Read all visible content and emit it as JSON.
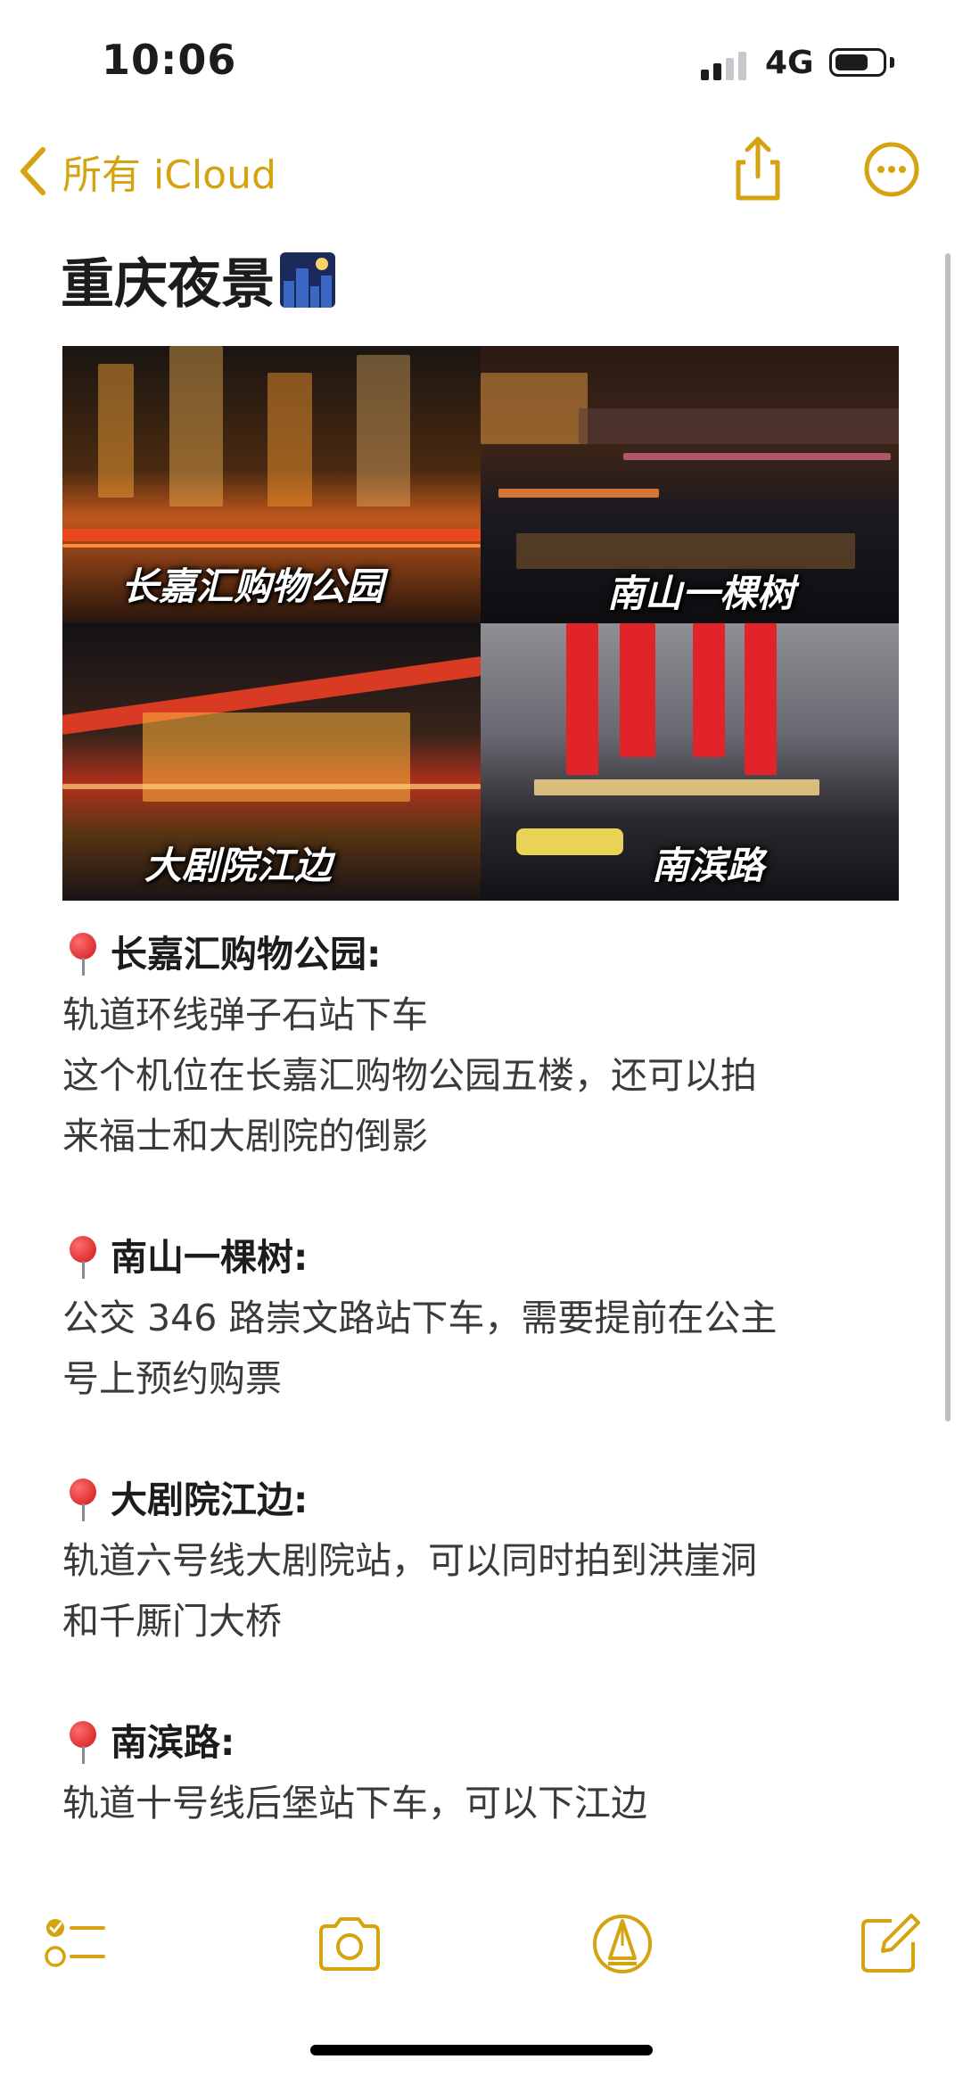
{
  "status_bar": {
    "time": "10:06",
    "network": "4G"
  },
  "nav": {
    "back_label": "所有 iCloud"
  },
  "note": {
    "title": "重庆夜景",
    "photos": [
      {
        "label": "长嘉汇购物公园"
      },
      {
        "label": "南山一棵树"
      },
      {
        "label": "大剧院江边"
      },
      {
        "label": "南滨路"
      }
    ],
    "sections": [
      {
        "heading": "长嘉汇购物公园:",
        "lines": [
          "轨道环线弹子石站下车",
          "这个机位在长嘉汇购物公园五楼，还可以拍",
          "来福士和大剧院的倒影"
        ]
      },
      {
        "heading": "南山一棵树:",
        "lines": [
          "公交 346 路崇文路站下车，需要提前在公主",
          "号上预约购票"
        ]
      },
      {
        "heading": "大剧院江边:",
        "lines": [
          "轨道六号线大剧院站，可以同时拍到洪崖洞",
          "和千厮门大桥"
        ]
      },
      {
        "heading": "南滨路:",
        "lines": [
          "轨道十号线后堡站下车，可以下江边"
        ]
      }
    ]
  },
  "toolbar": {
    "icons": [
      "checklist-icon",
      "camera-icon",
      "markup-pen-icon",
      "compose-icon"
    ]
  },
  "colors": {
    "accent": "#d4a30f",
    "text": "#1c1c1e",
    "pin": "#d0161b"
  }
}
